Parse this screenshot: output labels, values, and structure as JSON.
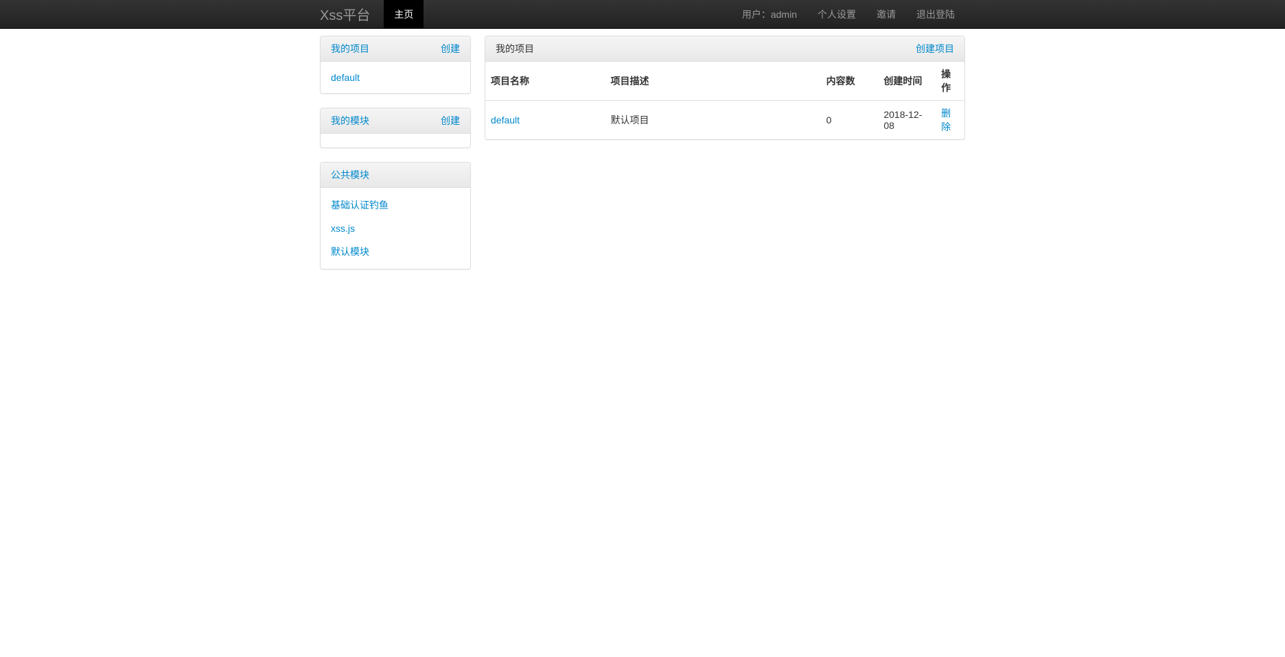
{
  "navbar": {
    "brand": "Xss平台",
    "home": "主页",
    "user_prefix": "用户：",
    "user_name": "admin",
    "profile": "个人设置",
    "invite": "邀请",
    "logout": "退出登陆"
  },
  "sidebar": {
    "my_projects": {
      "title": "我的项目",
      "create": "创建",
      "items": [
        "default"
      ]
    },
    "my_modules": {
      "title": "我的模块",
      "create": "创建"
    },
    "public_modules": {
      "title": "公共模块",
      "items": [
        "基础认证钓鱼",
        "xss.js",
        "默认模块"
      ]
    }
  },
  "main": {
    "title": "我的项目",
    "create": "创建项目",
    "table": {
      "headers": {
        "name": "项目名称",
        "desc": "项目描述",
        "count": "内容数",
        "date": "创建时间",
        "action": "操作"
      },
      "rows": [
        {
          "name": "default",
          "desc": "默认项目",
          "count": "0",
          "date": "2018-12-08",
          "action": "删除"
        }
      ]
    }
  }
}
